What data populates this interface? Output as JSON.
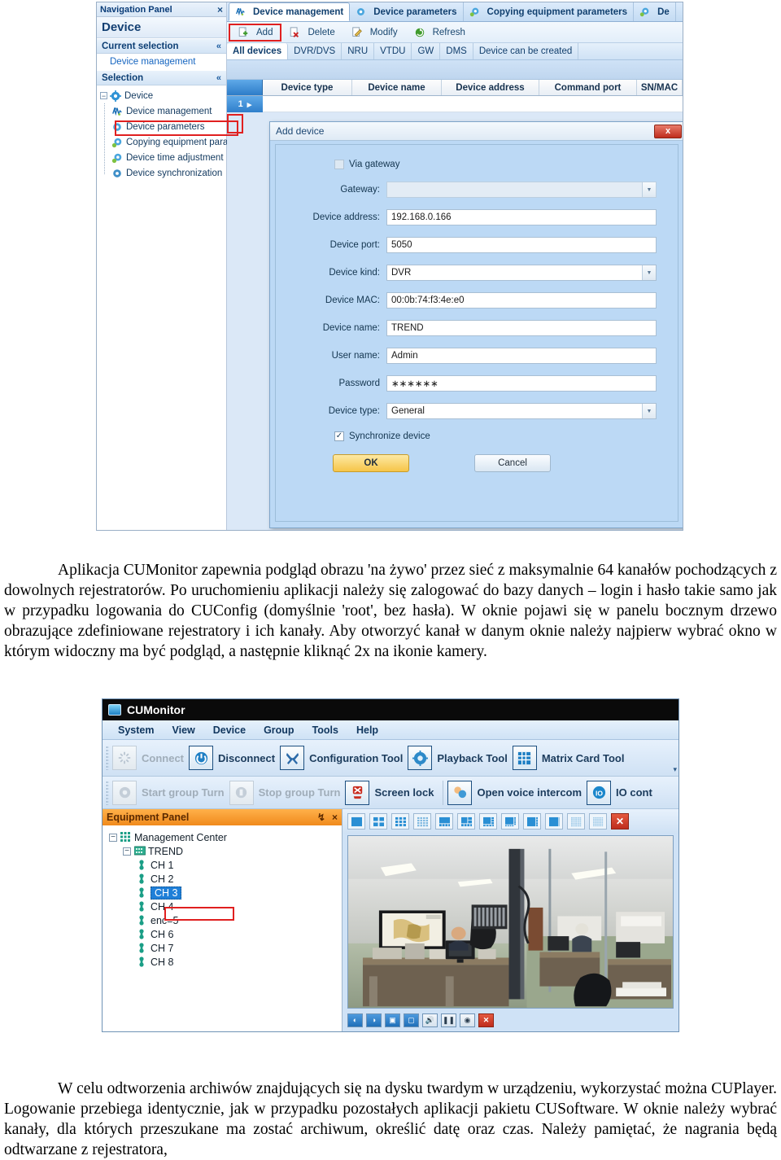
{
  "shot1": {
    "nav": {
      "panel_title": "Navigation Panel",
      "close_icon": "×",
      "device_title": "Device",
      "current_selection_label": "Current selection",
      "current_selection_value": "Device management",
      "selection_label": "Selection",
      "collapse_icon": "«",
      "root": "Device",
      "items": [
        {
          "label": "Device management",
          "icon": "device-management-icon",
          "highlighted": true
        },
        {
          "label": "Device parameters",
          "icon": "device-parameters-icon",
          "highlighted": false
        },
        {
          "label": "Copying equipment parameters",
          "icon": "copying-equipment-icon",
          "highlighted": false
        },
        {
          "label": "Device time adjustment",
          "icon": "device-time-icon",
          "highlighted": false
        },
        {
          "label": "Device synchronization",
          "icon": "device-sync-icon",
          "highlighted": false
        }
      ]
    },
    "tabs": [
      {
        "label": "Device management",
        "active": true
      },
      {
        "label": "Device parameters",
        "active": false
      },
      {
        "label": "Copying equipment parameters",
        "active": false
      },
      {
        "label": "De",
        "active": false
      }
    ],
    "commands": [
      {
        "label": "Add",
        "boxed": true
      },
      {
        "label": "Delete",
        "boxed": false
      },
      {
        "label": "Modify",
        "boxed": false
      },
      {
        "label": "Refresh",
        "boxed": false
      }
    ],
    "filters": [
      {
        "label": "All devices",
        "active": true
      },
      {
        "label": "DVR/DVS",
        "active": false
      },
      {
        "label": "NRU",
        "active": false
      },
      {
        "label": "VTDU",
        "active": false
      },
      {
        "label": "GW",
        "active": false
      },
      {
        "label": "DMS",
        "active": false
      },
      {
        "label": "Device can be created",
        "active": false
      }
    ],
    "grid": {
      "columns": [
        "Device type",
        "Device name",
        "Device address",
        "Command port",
        "SN/MAC"
      ],
      "row_number": "1",
      "row_marker": "▸"
    },
    "dialog": {
      "title": "Add device",
      "close_label": "x",
      "via_gateway_label": "Via gateway",
      "via_gateway_checked": false,
      "fields": [
        {
          "label": "Gateway:",
          "value": "",
          "type": "select",
          "disabled": true
        },
        {
          "label": "Device address:",
          "value": "192.168.0.166",
          "type": "text",
          "disabled": false
        },
        {
          "label": "Device port:",
          "value": "5050",
          "type": "text",
          "disabled": false
        },
        {
          "label": "Device kind:",
          "value": "DVR",
          "type": "select",
          "disabled": false
        },
        {
          "label": "Device MAC:",
          "value": "00:0b:74:f3:4e:e0",
          "type": "text",
          "disabled": false
        },
        {
          "label": "Device name:",
          "value": "TREND",
          "type": "text",
          "disabled": false
        },
        {
          "label": "User name:",
          "value": "Admin",
          "type": "text",
          "disabled": false
        },
        {
          "label": "Password",
          "value": "∗∗∗∗∗∗",
          "type": "text",
          "disabled": false
        },
        {
          "label": "Device type:",
          "value": "General",
          "type": "select",
          "disabled": false
        }
      ],
      "sync_label": "Synchronize device",
      "sync_checked": true,
      "ok_label": "OK",
      "cancel_label": "Cancel"
    }
  },
  "paragraph1": "Aplikacja CUMonitor zapewnia podgląd obrazu 'na żywo' przez sieć z maksymalnie 64 kanałów pochodzących z dowolnych rejestratorów. Po uruchomieniu aplikacji należy się zalogować do bazy danych – login i hasło takie samo jak w przypadku logowania do CUConfig (domyślnie 'root', bez hasła). W oknie pojawi się w panelu bocznym drzewo obrazujące zdefiniowane rejestratory i ich kanały. Aby otworzyć kanał w danym oknie należy najpierw wybrać okno w którym widoczny ma być podgląd, a następnie kliknąć 2x na ikonie kamery.",
  "paragraph2": "W celu odtworzenia archiwów znajdujących się na dysku twardym w urządzeniu, wykorzystać można CUPlayer. Logowanie przebiega identycznie, jak w przypadku pozostałych aplikacji pakietu CUSoftware. W oknie należy wybrać kanały, dla których przeszukane ma zostać archiwum, określić datę oraz czas. Należy pamiętać, że nagrania będą odtwarzane z rejestratora,",
  "shot2": {
    "window_title": "CUMonitor",
    "menu": [
      "System",
      "View",
      "Device",
      "Group",
      "Tools",
      "Help"
    ],
    "toolbar_row1": [
      {
        "label": "Connect",
        "icon": "connect-icon",
        "dim": true
      },
      {
        "label": "Disconnect",
        "icon": "power-icon",
        "dim": false
      },
      {
        "label": "Configuration Tool",
        "icon": "tools-icon",
        "dim": false
      },
      {
        "label": "Playback Tool",
        "icon": "playback-icon",
        "dim": false
      },
      {
        "label": "Matrix Card Tool",
        "icon": "matrix-icon",
        "dim": false
      }
    ],
    "toolbar_overflow": "▾",
    "toolbar_row2": [
      {
        "label": "Start group Turn",
        "icon": "refresh-gear-icon",
        "dim": true
      },
      {
        "label": "Stop group Turn",
        "icon": "stop-gear-icon",
        "dim": true
      },
      {
        "label": "Screen lock",
        "icon": "screen-lock-icon",
        "dim": false
      },
      {
        "label": "Open voice intercom",
        "icon": "voice-intercom-icon",
        "dim": false
      },
      {
        "label": "IO cont",
        "icon": "io-control-icon",
        "dim": false
      }
    ],
    "equipment_panel": {
      "title": "Equipment Panel",
      "pin_icon": "↯",
      "close_icon": "×",
      "root": "Management Center",
      "device": "TREND",
      "channels": [
        {
          "label": "CH 1",
          "selected": false
        },
        {
          "label": "CH 2",
          "selected": false
        },
        {
          "label": "CH 3",
          "selected": true
        },
        {
          "label": "CH 4",
          "selected": false
        },
        {
          "label": "enc=5",
          "selected": false
        },
        {
          "label": "CH 6",
          "selected": false
        },
        {
          "label": "CH 7",
          "selected": false
        },
        {
          "label": "CH 8",
          "selected": false
        }
      ]
    },
    "layout_buttons": [
      "layout-1x1-icon",
      "layout-2x2-icon",
      "layout-3x3-icon",
      "layout-4x4-icon",
      "layout-1plus5-icon",
      "layout-1plus7-icon",
      "layout-1plus9-icon",
      "layout-1plus12-icon",
      "layout-1plus8-icon",
      "layout-1plus6-icon",
      "layout-5x5-icon",
      "layout-6x6-icon"
    ],
    "layout_close_label": "✕",
    "video_controls": [
      "prev-channel-icon",
      "next-channel-icon",
      "zoom-out-icon",
      "zoom-in-icon",
      "audio-icon",
      "pause-icon",
      "ptz-icon",
      "close-stream-icon"
    ],
    "video_close_label": "✕"
  },
  "colors": {
    "highlight_red": "#e02020",
    "accent_blue": "#1f7fd8",
    "panel_orange": "#f08a1c",
    "ok_button_yellow": "#f6c548",
    "title_bar_black": "#0a0a0a"
  }
}
